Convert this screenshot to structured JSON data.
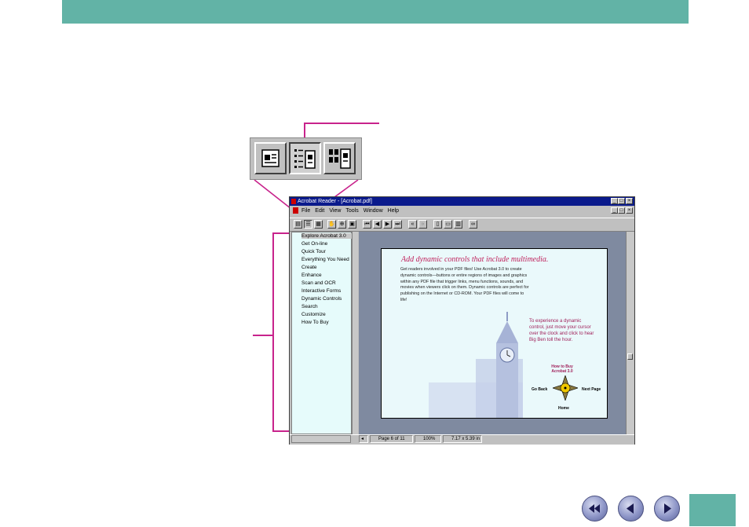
{
  "colors": {
    "accent": "#62b3a6",
    "callout": "#c8238c",
    "title_bar": "#0a1a8c",
    "headline": "#c0245e"
  },
  "window": {
    "title": "Acrobat Reader - [Acrobat.pdf]"
  },
  "menu": [
    "File",
    "Edit",
    "View",
    "Tools",
    "Window",
    "Help"
  ],
  "bookmarks": [
    "Explore Acrobat 3.0",
    "Get On-line",
    "Quick Tour",
    "Everything You Need",
    "Create",
    "Enhance",
    "Scan and OCR",
    "Interactive Forms",
    "Dynamic Controls",
    "Search",
    "Customize",
    "How To Buy"
  ],
  "page_content": {
    "headline": "Add dynamic controls that include multimedia.",
    "body": "Get readers involved in your PDF files! Use Acrobat 3.0 to create dynamic controls—buttons or entire regions of images and graphics within any PDF file that trigger links, menu functions, sounds, and movies when viewers click on them. Dynamic controls are perfect for publishing on the Internet or CD-ROM. Your PDF files will come to life!",
    "side_note": "To experience a dynamic control, just move your cursor over the clock and click to hear Big Ben toll the hour.",
    "nav_top": "How to Buy Acrobat 3.0",
    "nav_left": "Go Back",
    "nav_right": "Next Page",
    "nav_bottom": "Home"
  },
  "status": {
    "page": "Page 6 of 11",
    "zoom": "100%",
    "size": "7.17 x 5.39 in"
  },
  "icons": {
    "prev_section": "double-left-arrow-icon",
    "prev_page": "left-arrow-icon",
    "next_page": "right-arrow-icon"
  }
}
